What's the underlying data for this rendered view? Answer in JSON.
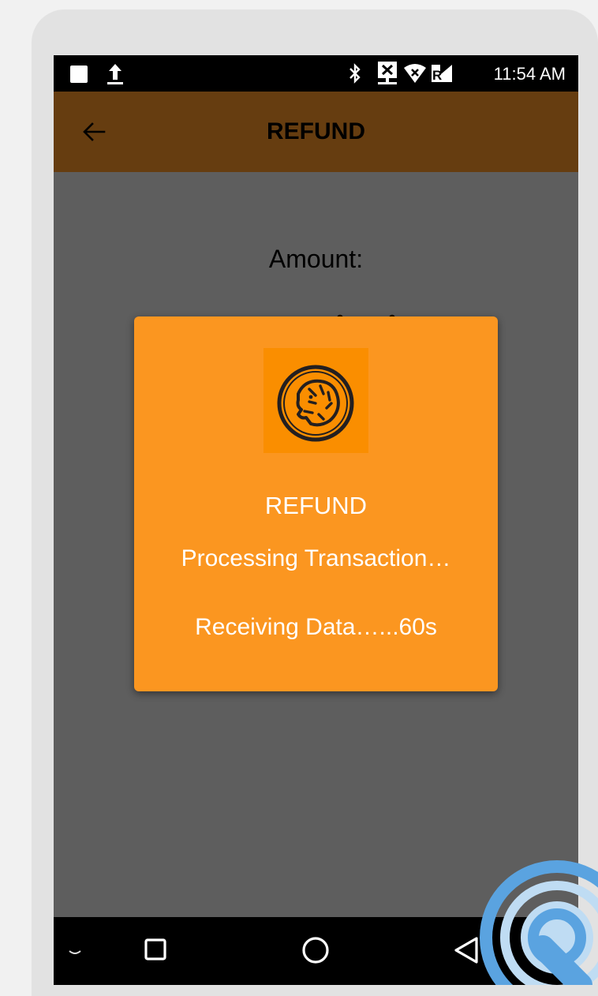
{
  "status_bar": {
    "time": "11:54 AM",
    "icons": [
      "notification-square-icon",
      "upload-icon",
      "bluetooth-icon",
      "network-icon",
      "wifi-icon",
      "signal-icon"
    ]
  },
  "app_bar": {
    "title": "REFUND",
    "back_icon": "back-arrow-icon",
    "color": "#663d10"
  },
  "form": {
    "amount_label": "Amount:"
  },
  "dialog": {
    "logo_icon": "tiger-logo-icon",
    "title": "REFUND",
    "message": "Processing Transaction…",
    "countdown": "Receiving Data…...60s",
    "color": "#fb9620"
  },
  "nav_bar": {
    "icons": [
      "keyboard-hide-icon",
      "recent-apps-icon",
      "home-icon",
      "back-icon"
    ]
  },
  "overlay": {
    "icon": "touch-indicator-icon",
    "color": "#5aa3e0"
  }
}
